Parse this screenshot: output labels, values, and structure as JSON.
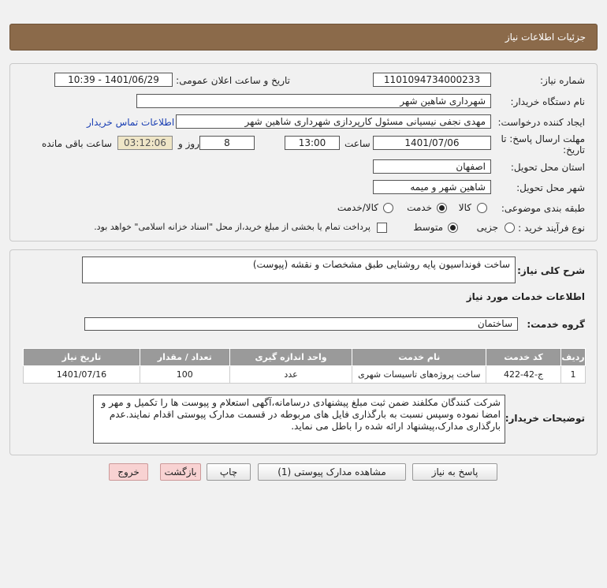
{
  "header": {
    "title": "جزئیات اطلاعات نیاز"
  },
  "form": {
    "need_number_label": "شماره نیاز:",
    "need_number": "1101094734000233",
    "announce_label": "تاریخ و ساعت اعلان عمومی:",
    "announce_value": "1401/06/29 - 10:39",
    "buyer_org_label": "نام دستگاه خریدار:",
    "buyer_org": "شهرداری شاهین شهر",
    "creator_label": "ایجاد کننده درخواست:",
    "creator": "مهدی نجفی نیسیانی مسئول کارپردازی شهرداری شاهین شهر",
    "contact_link": "اطلاعات تماس خریدار",
    "deadline_label_1": "مهلت ارسال پاسخ: تا",
    "deadline_label_2": "تاریخ:",
    "deadline_date": "1401/07/06",
    "time_label": "ساعت",
    "deadline_time": "13:00",
    "days_value": "8",
    "days_label": "روز و",
    "remaining_timer": "03:12:06",
    "remaining_label": "ساعت باقی مانده",
    "province_label": "استان محل تحویل:",
    "province": "اصفهان",
    "city_label": "شهر محل تحویل:",
    "city": "شاهین شهر و میمه",
    "category_label": "طبقه بندی موضوعی:",
    "category_options": [
      "کالا",
      "خدمت",
      "کالا/خدمت"
    ],
    "category_selected": "خدمت",
    "purchase_type_label": "نوع فرآیند خرید :",
    "purchase_options": [
      "جزیی",
      "متوسط"
    ],
    "purchase_selected": "متوسط",
    "payment_note": "پرداخت تمام یا بخشی از مبلغ خرید،از محل \"اسناد خزانه اسلامی\" خواهد بود."
  },
  "details": {
    "summary_label": "شرح کلی نیاز:",
    "summary": "ساخت فونداسیون پایه روشنایی طبق مشخصات و نقشه (پیوست)",
    "services_title": "اطلاعات خدمات مورد نیاز",
    "service_group_label": "گروه خدمت:",
    "service_group": "ساختمان",
    "table": {
      "headers": [
        "ردیف",
        "کد خدمت",
        "نام خدمت",
        "واحد اندازه گیری",
        "تعداد / مقدار",
        "تاریخ نیاز"
      ],
      "rows": [
        [
          "1",
          "ج-42-422",
          "ساخت پروژه‌های تاسیسات شهری",
          "عدد",
          "100",
          "1401/07/16"
        ]
      ]
    },
    "buyer_notes_label": "توضیحات خریدار:",
    "buyer_notes": "شرکت کنندگان مکلفند ضمن ثبت مبلغ پیشنهادی درسامانه،آگهی استعلام و پیوست ها را تکمیل و مهر و امضا نموده وسپس نسبت به بارگذاری فایل های مربوطه در قسمت مدارک پیوستی اقدام نمایند.عدم بارگذاری مدارک،پیشنهاد ارائه شده را باطل می نماید."
  },
  "buttons": {
    "reply": "پاسخ به نیاز",
    "attachments": "مشاهده مدارک پیوستی (1)",
    "print": "چاپ",
    "back": "بازگشت",
    "exit": "خروج"
  },
  "colors": {
    "header_bg": "#8b6a4a",
    "table_header_bg": "#9a9a9a",
    "link": "#1a3fb3",
    "timer_bg": "#efe6c7",
    "red_button_bg": "#f8d2d2"
  }
}
